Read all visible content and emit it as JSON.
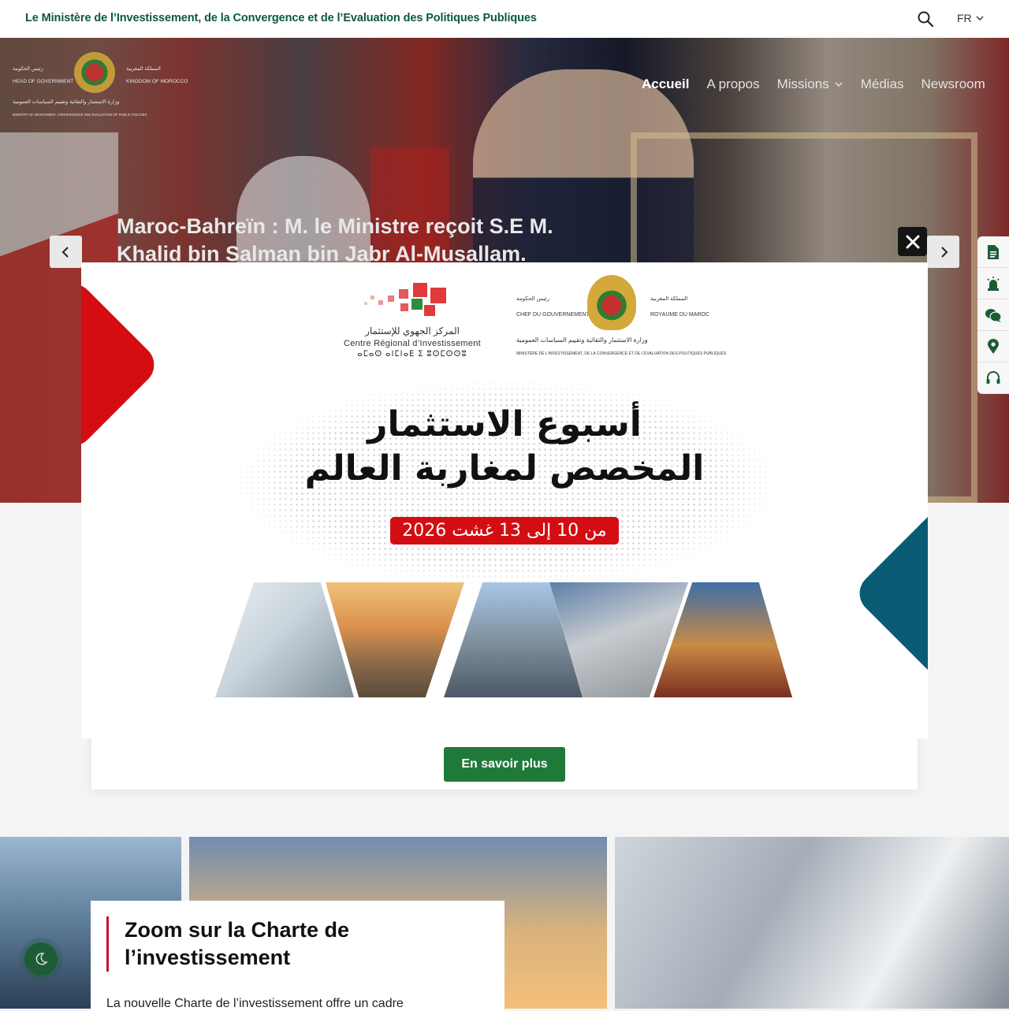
{
  "topbar": {
    "title": "Le Ministère de l’Investissement, de la Convergence et de l’Evaluation des Politiques Publiques",
    "search_icon": "search-icon",
    "lang": "FR"
  },
  "logo": {
    "line_ar_left": "رئيس الحكومة",
    "line_en_left": "HEAD OF GOVERNMENT",
    "line_ar_right": "المملكة المغربية",
    "line_en_right": "KINGDOM OF MOROCCO",
    "line_ar_bottom": "وزارة الاستثمار والتقائية وتقييم السياسات العمومية",
    "line_en_bottom": "MINISTRY OF INVESTMENT, CONVERGENCE AND EVALUATION OF PUBLIC POLICIES"
  },
  "nav": {
    "items": [
      {
        "label": "Accueil"
      },
      {
        "label": "A propos"
      },
      {
        "label": "Missions"
      },
      {
        "label": "Médias"
      },
      {
        "label": "Newsroom"
      }
    ]
  },
  "hero": {
    "title": "Maroc-Bahreïn : M. le Ministre reçoit S.E M. Khalid bin Salman bin Jabr Al-Musallam."
  },
  "side_toolbar": {
    "icons": [
      "document-icon",
      "alarm-icon",
      "chat-icon",
      "location-icon",
      "headset-icon"
    ]
  },
  "content": {
    "more_button": "En savoir plus",
    "zoom_title": "Zoom sur la Charte de l’investissement",
    "zoom_text": "La nouvelle Charte de l’investissement offre un cadre"
  },
  "modal": {
    "cri_ar": "المركز الجهوي للإستثمار",
    "cri_fr": "Centre Régional d’Investissement",
    "cri_tf": "ⴰⵎⴰⵙ ⴰⵏⵎⵏⴰⴹ ⵉ ⵓⵙⵎⵙⵙⵓ",
    "gov_ar_left": "رئيس الحكومة",
    "gov_fr_left": "CHEF DU GOUVERNEMENT",
    "gov_ar_right": "المملكة المغربية",
    "gov_fr_right": "ROYAUME DU MAROC",
    "gov_ar_bottom": "وزارة الاستثمار والتقائية وتقييم السياسات العمومية",
    "gov_fr_bottom": "MINISTÈRE DE L’INVESTISSEMENT, DE LA CONVERGENCE ET DE L’EVALUATION DES POLITIQUES PUBLIQUES",
    "headline_line1": "أسبوع الاستثمار",
    "headline_line2": "المخصص لمغاربة العالم",
    "date": "من 10 إلى 13 غشت 2026",
    "close_icon": "close-icon"
  },
  "colors": {
    "brand_green": "#0b5a36",
    "button_green": "#1f7a3a",
    "accent_red": "#d40d12",
    "accent_blue": "#0a5a73"
  }
}
